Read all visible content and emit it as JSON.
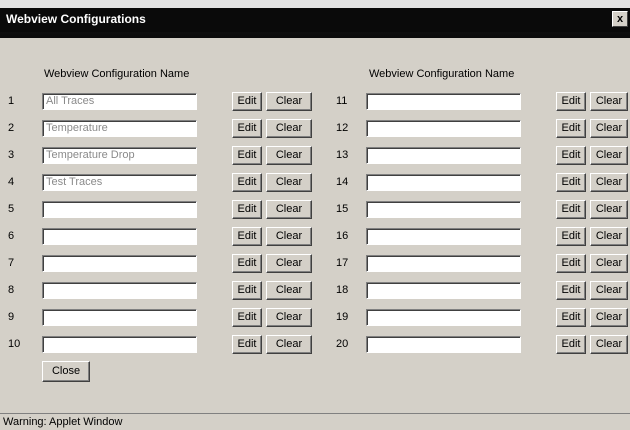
{
  "window": {
    "title": "Webview Configurations",
    "close_glyph": "x"
  },
  "columns": {
    "left_header": "Webview Configuration Name",
    "right_header": "Webview Configuration Name"
  },
  "rows": [
    {
      "num": "1",
      "value": "All Traces"
    },
    {
      "num": "2",
      "value": "Temperature"
    },
    {
      "num": "3",
      "value": "Temperature Drop"
    },
    {
      "num": "4",
      "value": "Test Traces"
    },
    {
      "num": "5",
      "value": ""
    },
    {
      "num": "6",
      "value": ""
    },
    {
      "num": "7",
      "value": ""
    },
    {
      "num": "8",
      "value": ""
    },
    {
      "num": "9",
      "value": ""
    },
    {
      "num": "10",
      "value": ""
    },
    {
      "num": "11",
      "value": ""
    },
    {
      "num": "12",
      "value": ""
    },
    {
      "num": "13",
      "value": ""
    },
    {
      "num": "14",
      "value": ""
    },
    {
      "num": "15",
      "value": ""
    },
    {
      "num": "16",
      "value": ""
    },
    {
      "num": "17",
      "value": ""
    },
    {
      "num": "18",
      "value": ""
    },
    {
      "num": "19",
      "value": ""
    },
    {
      "num": "20",
      "value": ""
    }
  ],
  "buttons": {
    "edit": "Edit",
    "clear": "Clear",
    "close": "Close"
  },
  "status": {
    "text": "Warning: Applet Window"
  }
}
